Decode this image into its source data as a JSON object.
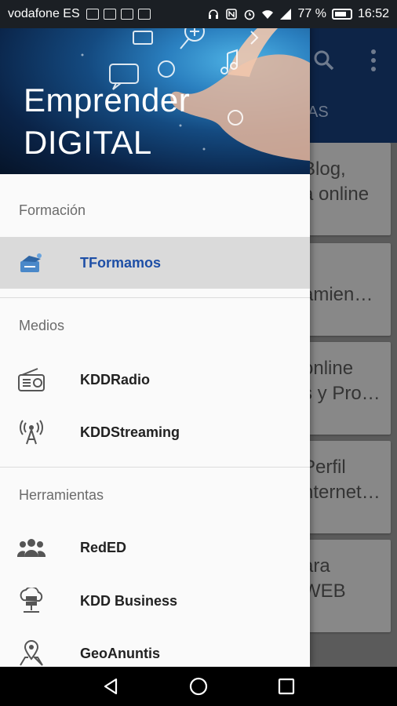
{
  "status_bar": {
    "carrier": "vodafone ES",
    "battery_percent": "77 %",
    "time": "16:52"
  },
  "drawer": {
    "header": {
      "title_line1": "Emprender",
      "title_line2": "DIGITAL"
    },
    "sections": [
      {
        "label": "Formación",
        "items": [
          {
            "label": "TFormamos",
            "icon": "training-icon",
            "active": true
          }
        ]
      },
      {
        "label": "Medios",
        "items": [
          {
            "label": "KDDRadio",
            "icon": "radio-icon",
            "active": false
          },
          {
            "label": "KDDStreaming",
            "icon": "antenna-icon",
            "active": false
          }
        ]
      },
      {
        "label": "Herramientas",
        "items": [
          {
            "label": "RedED",
            "icon": "people-icon",
            "active": false
          },
          {
            "label": "KDD Business",
            "icon": "cloud-server-icon",
            "active": false
          },
          {
            "label": "GeoAnuntis",
            "icon": "map-pin-icon",
            "active": false
          }
        ]
      }
    ],
    "accent_color": "#1e4fa6"
  },
  "background_app": {
    "tab_partial": "AS",
    "cards": [
      {
        "line1": "Blog,",
        "line2": "a online"
      },
      {
        "line1": "",
        "line2": "amien…"
      },
      {
        "line1": "online",
        "line2": "s y Pro…"
      },
      {
        "line1": "Perfil",
        "line2": "nternet…"
      },
      {
        "line1": "ara",
        "line2": "WEB"
      }
    ]
  }
}
